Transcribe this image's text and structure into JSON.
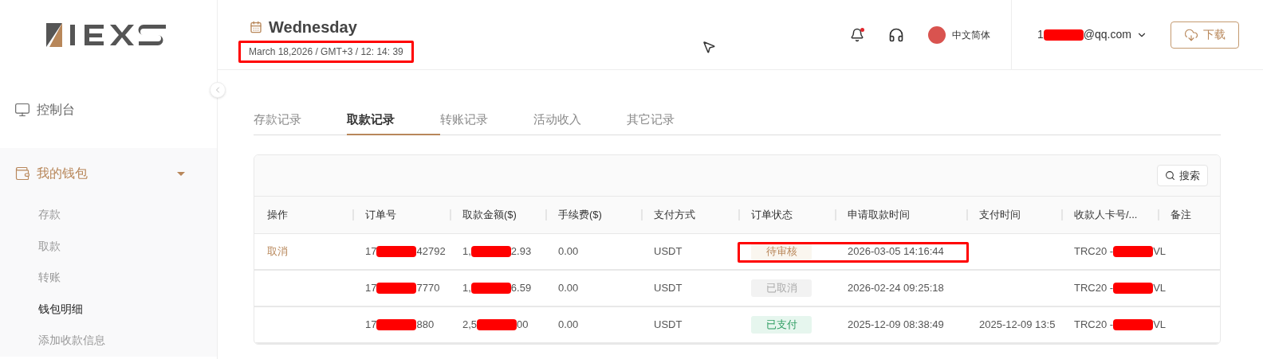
{
  "sidebar": {
    "items": [
      {
        "label": "控制台",
        "expanded": false
      },
      {
        "label": "我的钱包",
        "expanded": true,
        "children": [
          {
            "label": "存款",
            "selected": false
          },
          {
            "label": "取款",
            "selected": false
          },
          {
            "label": "转账",
            "selected": false
          },
          {
            "label": "钱包明细",
            "selected": true
          },
          {
            "label": "添加收款信息",
            "selected": false
          }
        ]
      }
    ]
  },
  "header": {
    "day": "Wednesday",
    "datetime": "March 18,2026 / GMT+3 / 12: 14: 39",
    "datetime_highlighted": true,
    "notification_dot": true,
    "language": "中文简体",
    "account": {
      "prefix": "1",
      "suffix": "@qq.com"
    },
    "download": "下载"
  },
  "tabs": [
    {
      "label": "存款记录",
      "selected": false
    },
    {
      "label": "取款记录",
      "selected": true
    },
    {
      "label": "转账记录",
      "selected": false
    },
    {
      "label": "活动收入",
      "selected": false
    },
    {
      "label": "其它记录",
      "selected": false
    }
  ],
  "table": {
    "search": "搜索",
    "columns": [
      "操作",
      "订单号",
      "取款金额($)",
      "手续费($)",
      "支付方式",
      "订单状态",
      "申请取款时间",
      "支付时间",
      "收款人卡号/...",
      "备注"
    ],
    "rows": [
      {
        "action": "取消",
        "order": {
          "prefix": "17",
          "suffix": "42792"
        },
        "amount": {
          "prefix": "1,",
          "suffix": "2.93"
        },
        "fee": "0.00",
        "method": "USDT",
        "status": {
          "text": "待审核",
          "kind": "pending"
        },
        "requested": "2026-03-05 14:16:44",
        "payee": {
          "prefix": "TRC20 -",
          "suffix": "VL"
        },
        "highlighted": true
      },
      {
        "order": {
          "prefix": "17",
          "suffix": "7770"
        },
        "amount": {
          "prefix": "1,",
          "suffix": "6.59"
        },
        "fee": "0.00",
        "method": "USDT",
        "status": {
          "text": "已取消",
          "kind": "cancelled"
        },
        "requested": "2026-02-24 09:25:18",
        "payee": {
          "prefix": "TRC20 -",
          "suffix": "VL"
        },
        "highlighted": false
      },
      {
        "order": {
          "prefix": "17",
          "suffix": "880"
        },
        "amount": {
          "prefix": "2,5",
          "suffix": "00"
        },
        "fee": "0.00",
        "method": "USDT",
        "status": {
          "text": "已支付",
          "kind": "paid"
        },
        "requested": "2025-12-09 08:38:49",
        "paid": "2025-12-09 13:5",
        "payee": {
          "prefix": "TRC20 -",
          "suffix": "VL"
        },
        "highlighted": false
      }
    ]
  }
}
